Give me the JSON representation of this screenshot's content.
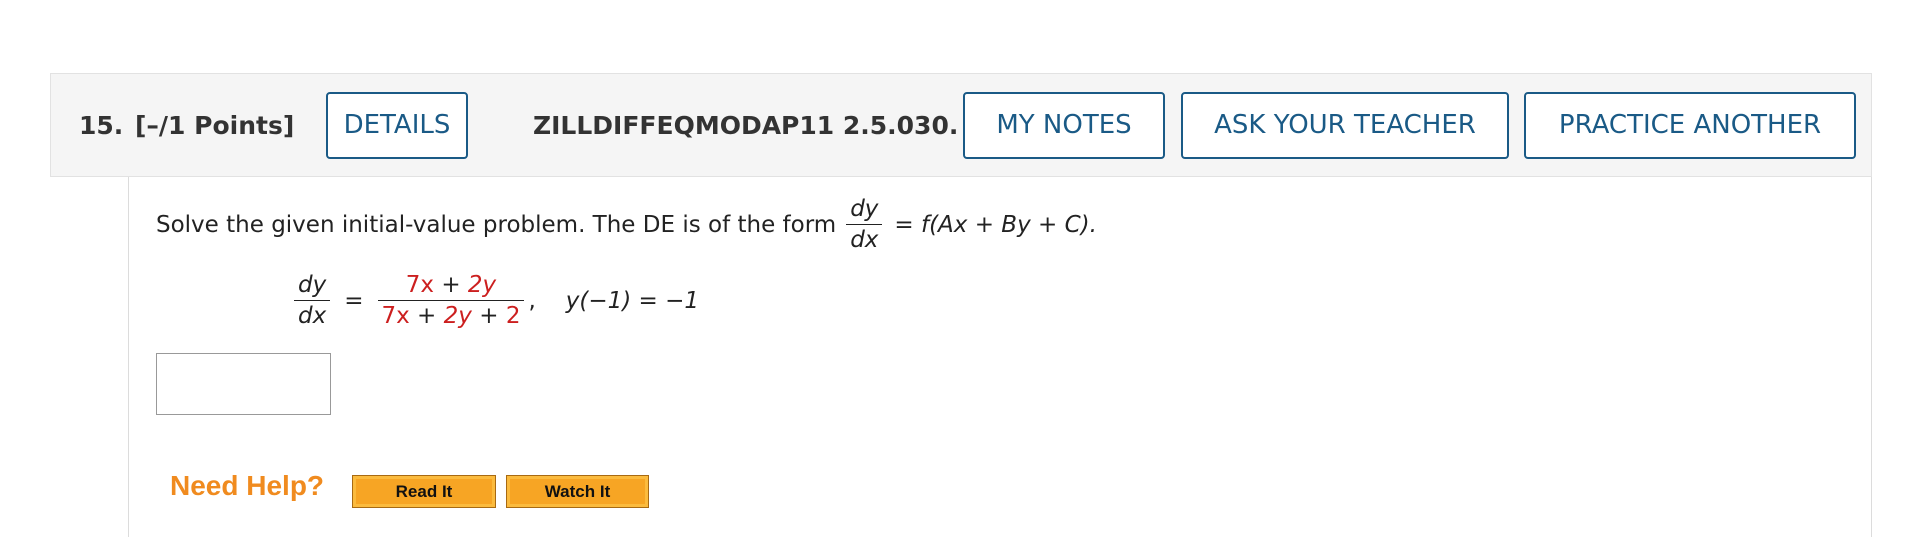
{
  "header": {
    "question_number": "15.",
    "points": "[–/1 Points]",
    "details_label": "DETAILS",
    "assignment_id": "ZILLDIFFEQMODAP11 2.5.030.",
    "my_notes_label": "MY NOTES",
    "ask_teacher_label": "ASK YOUR TEACHER",
    "practice_label": "PRACTICE ANOTHER"
  },
  "problem": {
    "prompt_text": "Solve the given initial-value problem. The DE is of the form",
    "form_num": "dy",
    "form_den": "dx",
    "form_rhs": "= f(Ax + By + C).",
    "lhs_num": "dy",
    "lhs_den": "dx",
    "equals": "=",
    "rhs_num_a": "7x",
    "rhs_num_plus": " + ",
    "rhs_num_b": "2y",
    "rhs_den_a": "7x",
    "rhs_den_plus1": " + ",
    "rhs_den_b": "2y",
    "rhs_den_plus2": " + ",
    "rhs_den_c": "2",
    "comma": ",",
    "initial_condition": "y(−1) = −1"
  },
  "answer": {
    "value": ""
  },
  "help": {
    "label": "Need Help?",
    "read_it": "Read It",
    "watch_it": "Watch It"
  },
  "colors": {
    "accent": "#1a5a86",
    "highlight": "#cc1f1f",
    "help_orange": "#f08b1f",
    "button_orange": "#f7a524"
  }
}
